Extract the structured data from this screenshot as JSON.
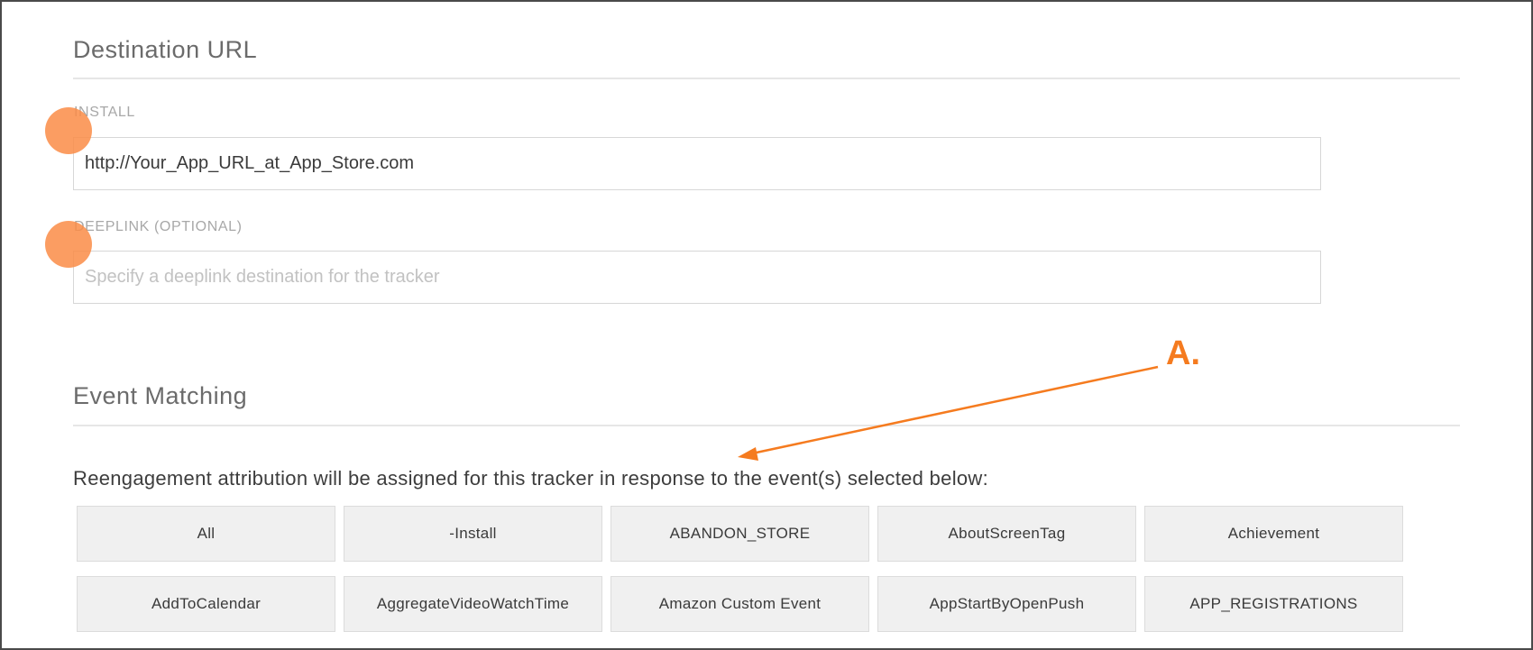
{
  "destination": {
    "title": "Destination URL",
    "install": {
      "label": "INSTALL",
      "value": "http://Your_App_URL_at_App_Store.com"
    },
    "deeplink": {
      "label": "DEEPLINK (OPTIONAL)",
      "value": "",
      "placeholder": "Specify a deeplink destination for the tracker"
    }
  },
  "event_matching": {
    "title": "Event Matching",
    "description": "Reengagement attribution will be assigned for this tracker in response to the event(s) selected below:",
    "events": [
      "All",
      "-Install",
      "ABANDON_STORE",
      "AboutScreenTag",
      "Achievement",
      "AddToCalendar",
      "AggregateVideoWatchTime",
      "Amazon Custom Event",
      "AppStartByOpenPush",
      "APP_REGISTRATIONS"
    ]
  },
  "annotation": {
    "label": "A.",
    "color": "#f57b1f"
  },
  "colors": {
    "marker": "#fa8c46",
    "button_bg": "#f0f0f0"
  }
}
